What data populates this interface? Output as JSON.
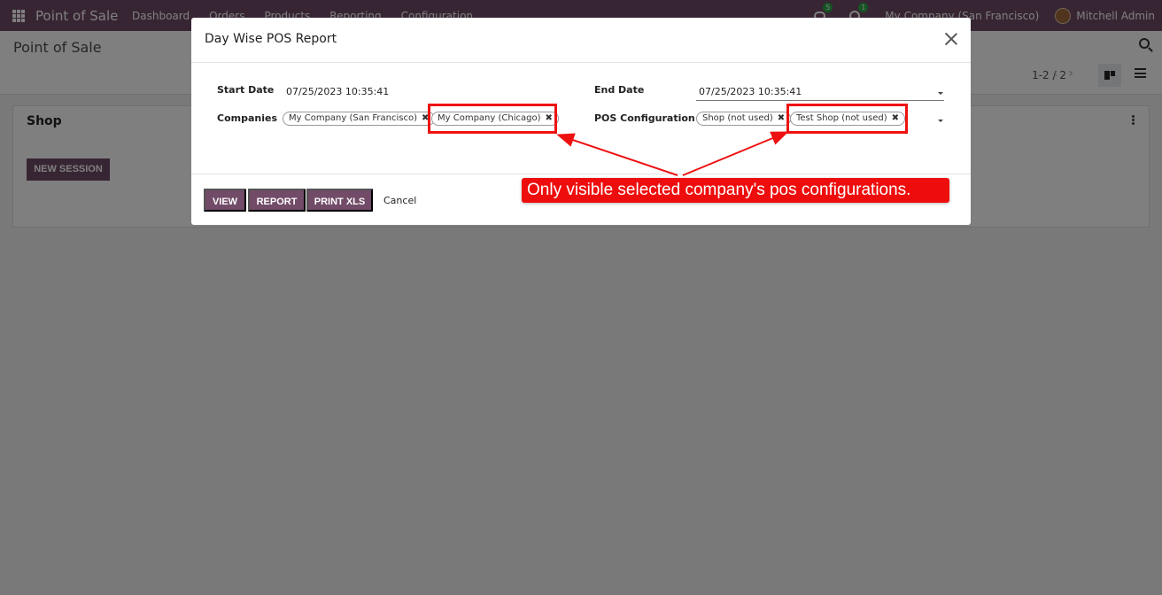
{
  "navbar": {
    "brand": "Point of Sale",
    "menu": [
      "Dashboard",
      "Orders",
      "Products",
      "Reporting",
      "Configuration"
    ],
    "chat_count": "5",
    "activity_count": "1",
    "company": "My Company (San Francisco)",
    "user": "Mitchell Admin"
  },
  "control_panel": {
    "title": "Point of Sale",
    "pager": "1-2 / 2",
    "prev_arrow": "‹",
    "next_arrow": "›"
  },
  "kanban": {
    "card_title": "Shop",
    "new_session_label": "NEW SESSION"
  },
  "modal": {
    "title": "Day Wise POS Report",
    "start_date_label": "Start Date",
    "start_date_value": "07/25/2023 10:35:41",
    "end_date_label": "End Date",
    "end_date_value": "07/25/2023 10:35:41",
    "companies_label": "Companies",
    "companies": [
      "My Company (San Francisco)",
      "My Company (Chicago)"
    ],
    "pos_config_label": "POS Configuration",
    "pos_configs": [
      "Shop (not used)",
      "Test Shop (not used)"
    ],
    "tag_remove_glyph": "✖",
    "buttons": {
      "view": "VIEW",
      "report": "REPORT",
      "print_xls": "PRINT XLS",
      "cancel": "Cancel"
    }
  },
  "annotation": {
    "text": "Only visible selected company's pos configurations.",
    "color": "#ee1111"
  },
  "colors": {
    "brand": "#714b67",
    "badge_green": "#28a745"
  }
}
